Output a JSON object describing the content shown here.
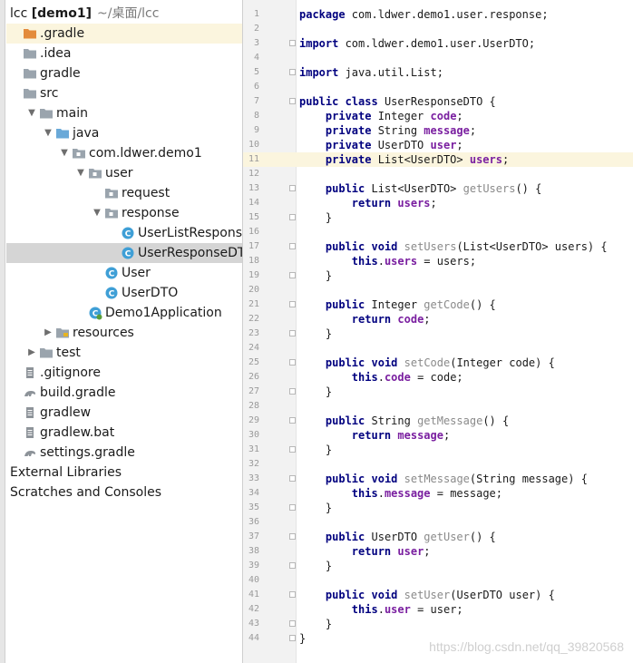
{
  "project_tree": {
    "root": {
      "name": "lcc",
      "module": "[demo1]",
      "path": "~/桌面/lcc"
    },
    "items": [
      {
        "label": "lcc",
        "indent": 0,
        "icon": "folder-icon",
        "expand": "none"
      },
      {
        "label": ".gradle",
        "indent": 0,
        "icon": "folder-orange-icon",
        "expand": "none"
      },
      {
        "label": ".idea",
        "indent": 0,
        "icon": "folder-icon",
        "expand": "none"
      },
      {
        "label": "gradle",
        "indent": 0,
        "icon": "folder-icon",
        "expand": "none"
      },
      {
        "label": "src",
        "indent": 0,
        "icon": "folder-icon",
        "expand": "none"
      },
      {
        "label": "main",
        "indent": 1,
        "icon": "folder-icon",
        "expand": "open"
      },
      {
        "label": "java",
        "indent": 2,
        "icon": "source-folder-icon",
        "expand": "open"
      },
      {
        "label": "com.ldwer.demo1",
        "indent": 3,
        "icon": "package-icon",
        "expand": "open"
      },
      {
        "label": "user",
        "indent": 4,
        "icon": "package-icon",
        "expand": "open"
      },
      {
        "label": "request",
        "indent": 5,
        "icon": "package-icon",
        "expand": "none"
      },
      {
        "label": "response",
        "indent": 5,
        "icon": "package-icon",
        "expand": "open"
      },
      {
        "label": "UserListResponseDTO",
        "indent": 6,
        "icon": "class-icon",
        "expand": "none"
      },
      {
        "label": "UserResponseDTO",
        "indent": 6,
        "icon": "class-icon",
        "expand": "none"
      },
      {
        "label": "User",
        "indent": 5,
        "icon": "class-icon",
        "expand": "none"
      },
      {
        "label": "UserDTO",
        "indent": 5,
        "icon": "class-icon",
        "expand": "none"
      },
      {
        "label": "Demo1Application",
        "indent": 4,
        "icon": "spring-class-icon",
        "expand": "none"
      },
      {
        "label": "resources",
        "indent": 2,
        "icon": "resources-folder-icon",
        "expand": "closed"
      },
      {
        "label": "test",
        "indent": 1,
        "icon": "folder-icon",
        "expand": "closed"
      },
      {
        "label": ".gitignore",
        "indent": 0,
        "icon": "text-file-icon",
        "expand": "none"
      },
      {
        "label": "build.gradle",
        "indent": 0,
        "icon": "gradle-icon",
        "expand": "none"
      },
      {
        "label": "gradlew",
        "indent": 0,
        "icon": "text-file-icon",
        "expand": "none"
      },
      {
        "label": "gradlew.bat",
        "indent": 0,
        "icon": "text-file-icon",
        "expand": "none"
      },
      {
        "label": "settings.gradle",
        "indent": 0,
        "icon": "gradle-icon",
        "expand": "none"
      },
      {
        "label": "External Libraries",
        "indent": 0,
        "icon": "none",
        "expand": "none"
      },
      {
        "label": "Scratches and Consoles",
        "indent": 0,
        "icon": "none",
        "expand": "none"
      }
    ],
    "highlighted_item": ".gradle",
    "selected_item": "UserResponseDTO"
  },
  "editor": {
    "current_line": 11,
    "lines": [
      {
        "n": "1",
        "text": "package com.ldwer.demo1.user.response;"
      },
      {
        "n": "2",
        "text": ""
      },
      {
        "n": "3",
        "text": "import com.ldwer.demo1.user.UserDTO;"
      },
      {
        "n": "4",
        "text": ""
      },
      {
        "n": "5",
        "text": "import java.util.List;"
      },
      {
        "n": "6",
        "text": ""
      },
      {
        "n": "7",
        "text": "public class UserResponseDTO {"
      },
      {
        "n": "8",
        "text": "    private Integer code;"
      },
      {
        "n": "9",
        "text": "    private String message;"
      },
      {
        "n": "10",
        "text": "    private UserDTO user;"
      },
      {
        "n": "11",
        "text": "    private List<UserDTO> users;"
      },
      {
        "n": "12",
        "text": ""
      },
      {
        "n": "13",
        "text": "    public List<UserDTO> getUsers() {"
      },
      {
        "n": "14",
        "text": "        return users;"
      },
      {
        "n": "15",
        "text": "    }"
      },
      {
        "n": "16",
        "text": ""
      },
      {
        "n": "17",
        "text": "    public void setUsers(List<UserDTO> users) {"
      },
      {
        "n": "18",
        "text": "        this.users = users;"
      },
      {
        "n": "19",
        "text": "    }"
      },
      {
        "n": "20",
        "text": ""
      },
      {
        "n": "21",
        "text": "    public Integer getCode() {"
      },
      {
        "n": "22",
        "text": "        return code;"
      },
      {
        "n": "23",
        "text": "    }"
      },
      {
        "n": "24",
        "text": ""
      },
      {
        "n": "25",
        "text": "    public void setCode(Integer code) {"
      },
      {
        "n": "26",
        "text": "        this.code = code;"
      },
      {
        "n": "27",
        "text": "    }"
      },
      {
        "n": "28",
        "text": ""
      },
      {
        "n": "29",
        "text": "    public String getMessage() {"
      },
      {
        "n": "30",
        "text": "        return message;"
      },
      {
        "n": "31",
        "text": "    }"
      },
      {
        "n": "32",
        "text": ""
      },
      {
        "n": "33",
        "text": "    public void setMessage(String message) {"
      },
      {
        "n": "34",
        "text": "        this.message = message;"
      },
      {
        "n": "35",
        "text": "    }"
      },
      {
        "n": "36",
        "text": ""
      },
      {
        "n": "37",
        "text": "    public UserDTO getUser() {"
      },
      {
        "n": "38",
        "text": "        return user;"
      },
      {
        "n": "39",
        "text": "    }"
      },
      {
        "n": "40",
        "text": ""
      },
      {
        "n": "41",
        "text": "    public void setUser(UserDTO user) {"
      },
      {
        "n": "42",
        "text": "        this.user = user;"
      },
      {
        "n": "43",
        "text": "    }"
      },
      {
        "n": "44",
        "text": "}"
      }
    ]
  },
  "watermark": "https://blog.csdn.net/qq_39820568",
  "colors": {
    "keyword": "#00007f",
    "field": "#7a1fa0",
    "method_decl": "#8a8a8a",
    "current_line_bg": "#fbf5de",
    "selected_bg": "#d5d5d5",
    "class_icon": "#3f9fd6"
  }
}
